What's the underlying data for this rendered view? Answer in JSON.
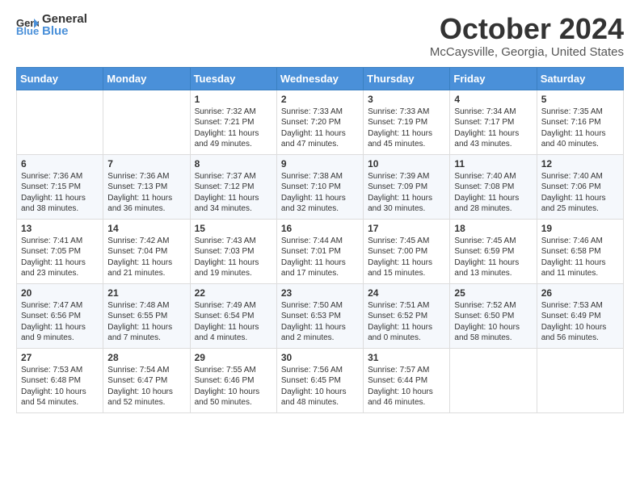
{
  "header": {
    "logo_general": "General",
    "logo_blue": "Blue",
    "month": "October 2024",
    "location": "McCaysville, Georgia, United States"
  },
  "days_of_week": [
    "Sunday",
    "Monday",
    "Tuesday",
    "Wednesday",
    "Thursday",
    "Friday",
    "Saturday"
  ],
  "weeks": [
    [
      {
        "day": "",
        "lines": []
      },
      {
        "day": "",
        "lines": []
      },
      {
        "day": "1",
        "lines": [
          "Sunrise: 7:32 AM",
          "Sunset: 7:21 PM",
          "Daylight: 11 hours",
          "and 49 minutes."
        ]
      },
      {
        "day": "2",
        "lines": [
          "Sunrise: 7:33 AM",
          "Sunset: 7:20 PM",
          "Daylight: 11 hours",
          "and 47 minutes."
        ]
      },
      {
        "day": "3",
        "lines": [
          "Sunrise: 7:33 AM",
          "Sunset: 7:19 PM",
          "Daylight: 11 hours",
          "and 45 minutes."
        ]
      },
      {
        "day": "4",
        "lines": [
          "Sunrise: 7:34 AM",
          "Sunset: 7:17 PM",
          "Daylight: 11 hours",
          "and 43 minutes."
        ]
      },
      {
        "day": "5",
        "lines": [
          "Sunrise: 7:35 AM",
          "Sunset: 7:16 PM",
          "Daylight: 11 hours",
          "and 40 minutes."
        ]
      }
    ],
    [
      {
        "day": "6",
        "lines": [
          "Sunrise: 7:36 AM",
          "Sunset: 7:15 PM",
          "Daylight: 11 hours",
          "and 38 minutes."
        ]
      },
      {
        "day": "7",
        "lines": [
          "Sunrise: 7:36 AM",
          "Sunset: 7:13 PM",
          "Daylight: 11 hours",
          "and 36 minutes."
        ]
      },
      {
        "day": "8",
        "lines": [
          "Sunrise: 7:37 AM",
          "Sunset: 7:12 PM",
          "Daylight: 11 hours",
          "and 34 minutes."
        ]
      },
      {
        "day": "9",
        "lines": [
          "Sunrise: 7:38 AM",
          "Sunset: 7:10 PM",
          "Daylight: 11 hours",
          "and 32 minutes."
        ]
      },
      {
        "day": "10",
        "lines": [
          "Sunrise: 7:39 AM",
          "Sunset: 7:09 PM",
          "Daylight: 11 hours",
          "and 30 minutes."
        ]
      },
      {
        "day": "11",
        "lines": [
          "Sunrise: 7:40 AM",
          "Sunset: 7:08 PM",
          "Daylight: 11 hours",
          "and 28 minutes."
        ]
      },
      {
        "day": "12",
        "lines": [
          "Sunrise: 7:40 AM",
          "Sunset: 7:06 PM",
          "Daylight: 11 hours",
          "and 25 minutes."
        ]
      }
    ],
    [
      {
        "day": "13",
        "lines": [
          "Sunrise: 7:41 AM",
          "Sunset: 7:05 PM",
          "Daylight: 11 hours",
          "and 23 minutes."
        ]
      },
      {
        "day": "14",
        "lines": [
          "Sunrise: 7:42 AM",
          "Sunset: 7:04 PM",
          "Daylight: 11 hours",
          "and 21 minutes."
        ]
      },
      {
        "day": "15",
        "lines": [
          "Sunrise: 7:43 AM",
          "Sunset: 7:03 PM",
          "Daylight: 11 hours",
          "and 19 minutes."
        ]
      },
      {
        "day": "16",
        "lines": [
          "Sunrise: 7:44 AM",
          "Sunset: 7:01 PM",
          "Daylight: 11 hours",
          "and 17 minutes."
        ]
      },
      {
        "day": "17",
        "lines": [
          "Sunrise: 7:45 AM",
          "Sunset: 7:00 PM",
          "Daylight: 11 hours",
          "and 15 minutes."
        ]
      },
      {
        "day": "18",
        "lines": [
          "Sunrise: 7:45 AM",
          "Sunset: 6:59 PM",
          "Daylight: 11 hours",
          "and 13 minutes."
        ]
      },
      {
        "day": "19",
        "lines": [
          "Sunrise: 7:46 AM",
          "Sunset: 6:58 PM",
          "Daylight: 11 hours",
          "and 11 minutes."
        ]
      }
    ],
    [
      {
        "day": "20",
        "lines": [
          "Sunrise: 7:47 AM",
          "Sunset: 6:56 PM",
          "Daylight: 11 hours",
          "and 9 minutes."
        ]
      },
      {
        "day": "21",
        "lines": [
          "Sunrise: 7:48 AM",
          "Sunset: 6:55 PM",
          "Daylight: 11 hours",
          "and 7 minutes."
        ]
      },
      {
        "day": "22",
        "lines": [
          "Sunrise: 7:49 AM",
          "Sunset: 6:54 PM",
          "Daylight: 11 hours",
          "and 4 minutes."
        ]
      },
      {
        "day": "23",
        "lines": [
          "Sunrise: 7:50 AM",
          "Sunset: 6:53 PM",
          "Daylight: 11 hours",
          "and 2 minutes."
        ]
      },
      {
        "day": "24",
        "lines": [
          "Sunrise: 7:51 AM",
          "Sunset: 6:52 PM",
          "Daylight: 11 hours",
          "and 0 minutes."
        ]
      },
      {
        "day": "25",
        "lines": [
          "Sunrise: 7:52 AM",
          "Sunset: 6:50 PM",
          "Daylight: 10 hours",
          "and 58 minutes."
        ]
      },
      {
        "day": "26",
        "lines": [
          "Sunrise: 7:53 AM",
          "Sunset: 6:49 PM",
          "Daylight: 10 hours",
          "and 56 minutes."
        ]
      }
    ],
    [
      {
        "day": "27",
        "lines": [
          "Sunrise: 7:53 AM",
          "Sunset: 6:48 PM",
          "Daylight: 10 hours",
          "and 54 minutes."
        ]
      },
      {
        "day": "28",
        "lines": [
          "Sunrise: 7:54 AM",
          "Sunset: 6:47 PM",
          "Daylight: 10 hours",
          "and 52 minutes."
        ]
      },
      {
        "day": "29",
        "lines": [
          "Sunrise: 7:55 AM",
          "Sunset: 6:46 PM",
          "Daylight: 10 hours",
          "and 50 minutes."
        ]
      },
      {
        "day": "30",
        "lines": [
          "Sunrise: 7:56 AM",
          "Sunset: 6:45 PM",
          "Daylight: 10 hours",
          "and 48 minutes."
        ]
      },
      {
        "day": "31",
        "lines": [
          "Sunrise: 7:57 AM",
          "Sunset: 6:44 PM",
          "Daylight: 10 hours",
          "and 46 minutes."
        ]
      },
      {
        "day": "",
        "lines": []
      },
      {
        "day": "",
        "lines": []
      }
    ]
  ]
}
